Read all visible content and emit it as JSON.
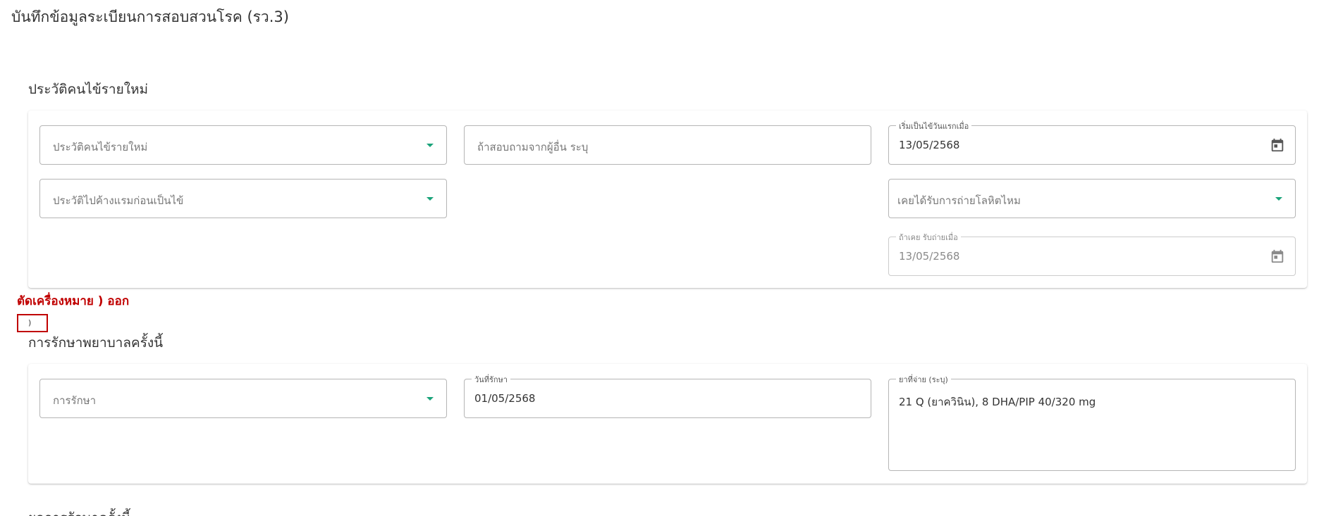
{
  "page": {
    "title": "บันทึกข้อมูลระเบียนการสอบสวนโรค (รว.3)"
  },
  "section_history": {
    "title": "ประวัติคนไข้รายใหม่",
    "fields": {
      "patient_history_placeholder": "ประวัติคนไข้รายใหม่",
      "ask_others_placeholder": "ถ้าสอบถามจากผู้อื่น ระบุ",
      "first_sick_label": "เริ่มเป็นไข้วันแรกเมื่อ",
      "first_sick_value": "13/05/2568",
      "overnight_placeholder": "ประวัติไปค้างแรมก่อนเป็นไข้",
      "transfusion_placeholder": "เคยได้รับการถ่ายโลหิตไหม",
      "transfusion_date_label": "ถ้าเคย รับถ่ายเมื่อ",
      "transfusion_date_value": "13/05/2568"
    }
  },
  "annotation": {
    "text": "ตัดเครื่องหมาย ) ออก",
    "box_text": ")"
  },
  "section_treatment": {
    "title": "การรักษาพยาบาลครั้งนี้",
    "fields": {
      "treatment_placeholder": "การรักษา",
      "treatment_date_label": "วันที่รักษา",
      "treatment_date_value": "01/05/2568",
      "medicine_label": "ยาที่จ่าย (ระบุ)",
      "medicine_value": "21 Q (ยาควินิน), 8 DHA/PIP 40/320 mg"
    }
  },
  "bottom_section": {
    "title": "ผลการรักษาครั้งนี้"
  },
  "colors": {
    "accent": "#1aa37a",
    "annotation": "#c00000",
    "border": "#b5b5b5"
  },
  "icons": [
    "dropdown-arrow-icon",
    "calendar-icon"
  ]
}
